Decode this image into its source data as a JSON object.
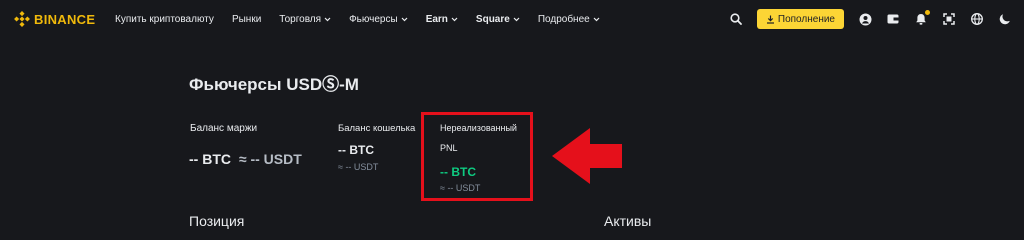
{
  "header": {
    "brand": "BINANCE",
    "nav": [
      {
        "label": "Купить криптовалюту",
        "dropdown": false,
        "bold": false
      },
      {
        "label": "Рынки",
        "dropdown": false,
        "bold": false
      },
      {
        "label": "Торговля",
        "dropdown": true,
        "bold": false
      },
      {
        "label": "Фьючерсы",
        "dropdown": true,
        "bold": false
      },
      {
        "label": "Earn",
        "dropdown": true,
        "bold": true
      },
      {
        "label": "Square",
        "dropdown": true,
        "bold": true
      },
      {
        "label": "Подробнее",
        "dropdown": true,
        "bold": false
      }
    ],
    "deposit_label": "Пополнение",
    "icons": [
      "search-icon",
      "deposit-icon",
      "user-icon",
      "wallet-icon",
      "bell-icon",
      "scan-icon",
      "globe-icon",
      "theme-icon"
    ]
  },
  "main": {
    "title": "Фьючерсы USDⓈ-M",
    "margin_balance": {
      "label": "Баланс маржи",
      "btc": "-- BTC",
      "usdt": "≈ -- USDT"
    },
    "wallet_balance": {
      "label": "Баланс кошелька",
      "btc": "-- BTC",
      "usdt": "≈ -- USDT"
    },
    "unrealized_pnl": {
      "label_line1": "Нереализованный",
      "label_line2": "PNL",
      "btc": "-- BTC",
      "usdt": "≈ -- USDT"
    },
    "positions_title": "Позиция",
    "assets_title": "Активы"
  },
  "colors": {
    "background": "#17181c",
    "accent": "#fcd535",
    "brand": "#f0b90b",
    "positive": "#0ecb81",
    "annotation": "#e5101b"
  }
}
